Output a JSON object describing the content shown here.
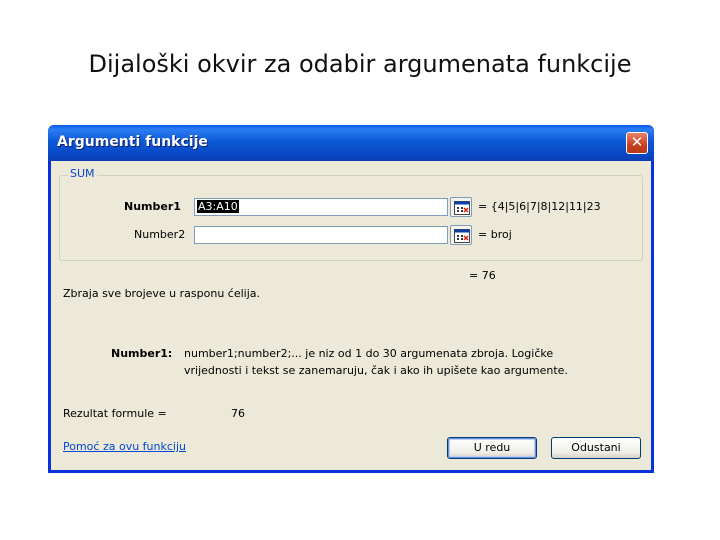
{
  "slide": {
    "title": "Dijaloški okvir za odabir argumenata funkcije"
  },
  "dialog": {
    "title": "Argumenti funkcije",
    "close_label": "✕",
    "function_name": "SUM",
    "args": [
      {
        "label": "Number1",
        "value": "A3:A10",
        "result": "= {4|5|6|7|8|12|11|23"
      },
      {
        "label": "Number2",
        "value": "",
        "result": "= broj"
      }
    ],
    "total_result": "= 76",
    "description": "Zbraja sve brojeve u rasponu ćelija.",
    "arg_help_label": "Number1:",
    "arg_help_line1": "number1;number2;... je niz od 1 do 30 argumenata zbroja. Logičke",
    "arg_help_line2": "vrijednosti i tekst se zanemaruju, čak i ako ih upišete kao argumente.",
    "formula_result_label": "Rezultat formule =",
    "formula_result_value": "76",
    "help_link": "Pomoć za ovu funkciju",
    "ok_label": "U redu",
    "cancel_label": "Odustani"
  },
  "icons": {
    "collapse": "collapse-dialog-icon",
    "close": "close-icon"
  },
  "colors": {
    "titlebar": "#0d58d6",
    "dialog_bg": "#ece9d8",
    "accent": "#0046d5",
    "close": "#c8401e"
  }
}
